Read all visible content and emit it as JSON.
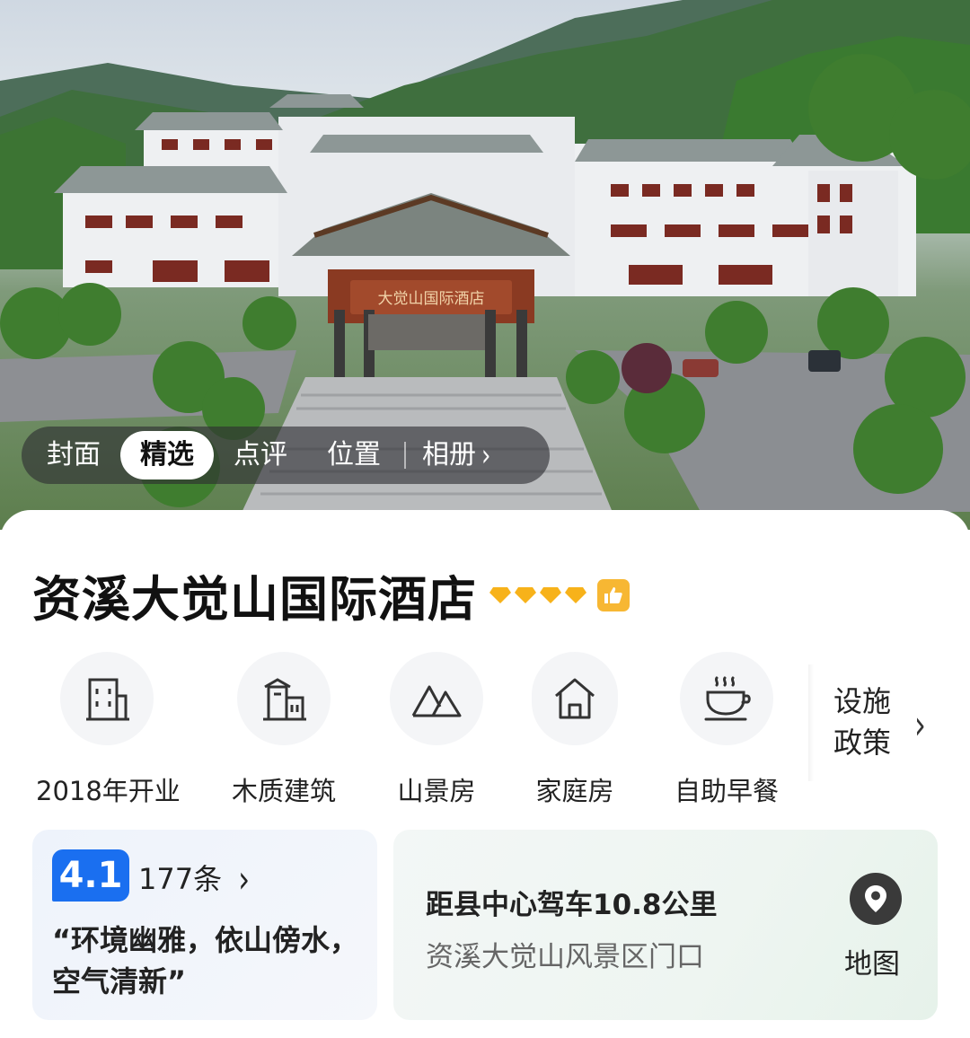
{
  "gallery_tabs": {
    "items": [
      {
        "label": "封面",
        "active": false
      },
      {
        "label": "精选",
        "active": true
      },
      {
        "label": "点评",
        "active": false
      },
      {
        "label": "位置",
        "active": false
      },
      {
        "label": "相册",
        "active": false
      }
    ],
    "album_icon": "chevron-right-icon"
  },
  "hotel": {
    "name": "资溪大觉山国际酒店",
    "diamond_rating": 4,
    "diamond_color": "#f7b21a",
    "badge_icon": "thumbs-up-icon",
    "sign_text": "大觉山国际酒店"
  },
  "facilities": {
    "items": [
      {
        "label": "2018年开业",
        "icon": "building-icon"
      },
      {
        "label": "木质建筑",
        "icon": "wooden-building-icon"
      },
      {
        "label": "山景房",
        "icon": "mountain-icon"
      },
      {
        "label": "家庭房",
        "icon": "house-icon"
      },
      {
        "label": "自助早餐",
        "icon": "coffee-cup-icon"
      }
    ],
    "more_label_line1": "设施",
    "more_label_line2": "政策"
  },
  "reviews": {
    "score": "4.1",
    "count_label": "177条",
    "quote": "“环境幽雅，依山傍水，空气清新”",
    "score_color": "#1a6ff0"
  },
  "location": {
    "distance": "距县中心驾车10.8公里",
    "address": "资溪大觉山风景区门口",
    "map_label": "地图",
    "pin_icon": "map-pin-icon"
  }
}
